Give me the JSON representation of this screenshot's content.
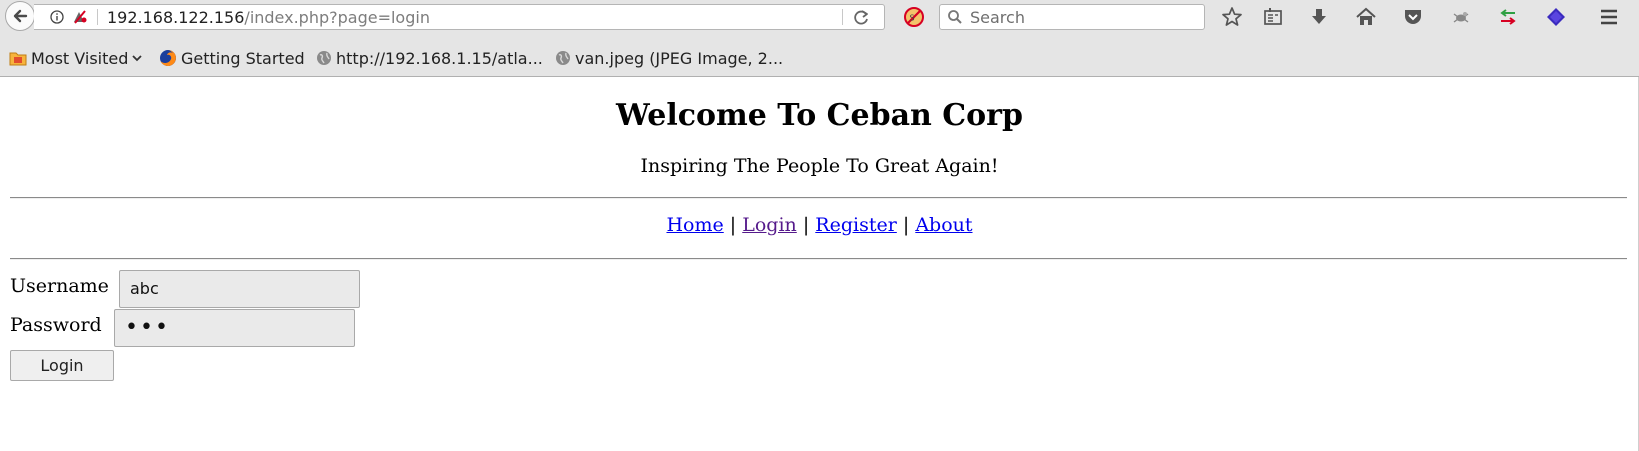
{
  "browser": {
    "url_host": "192.168.122.156",
    "url_path": "/index.php?page=login",
    "search_placeholder": "Search",
    "bookmarks": [
      {
        "label": "Most Visited",
        "icon": "folder-icon",
        "dropdown": true
      },
      {
        "label": "Getting Started",
        "icon": "firefox-icon"
      },
      {
        "label": "http://192.168.1.15/atla...",
        "icon": "globe-icon"
      },
      {
        "label": "van.jpeg (JPEG Image, 2...",
        "icon": "globe-icon"
      }
    ],
    "toolbar_icons": [
      "noscript-icon",
      "star-icon",
      "reading-list-icon",
      "download-icon",
      "home-icon",
      "pocket-icon",
      "bug-icon",
      "proxy-arrows-icon",
      "layers-icon",
      "menu-icon"
    ]
  },
  "page": {
    "title": "Welcome To Ceban Corp",
    "tagline": "Inspiring The People To Great Again!",
    "nav": {
      "home": "Home",
      "login": "Login",
      "register": "Register",
      "about": "About",
      "separator": "|"
    },
    "form": {
      "username_label": "Username",
      "username_value": "abc",
      "password_label": "Password",
      "password_value": "•••",
      "submit_label": "Login"
    }
  },
  "colors": {
    "link": "#0000ee",
    "visited_link": "#551a8b",
    "chrome_bg": "#e5e5e5"
  }
}
